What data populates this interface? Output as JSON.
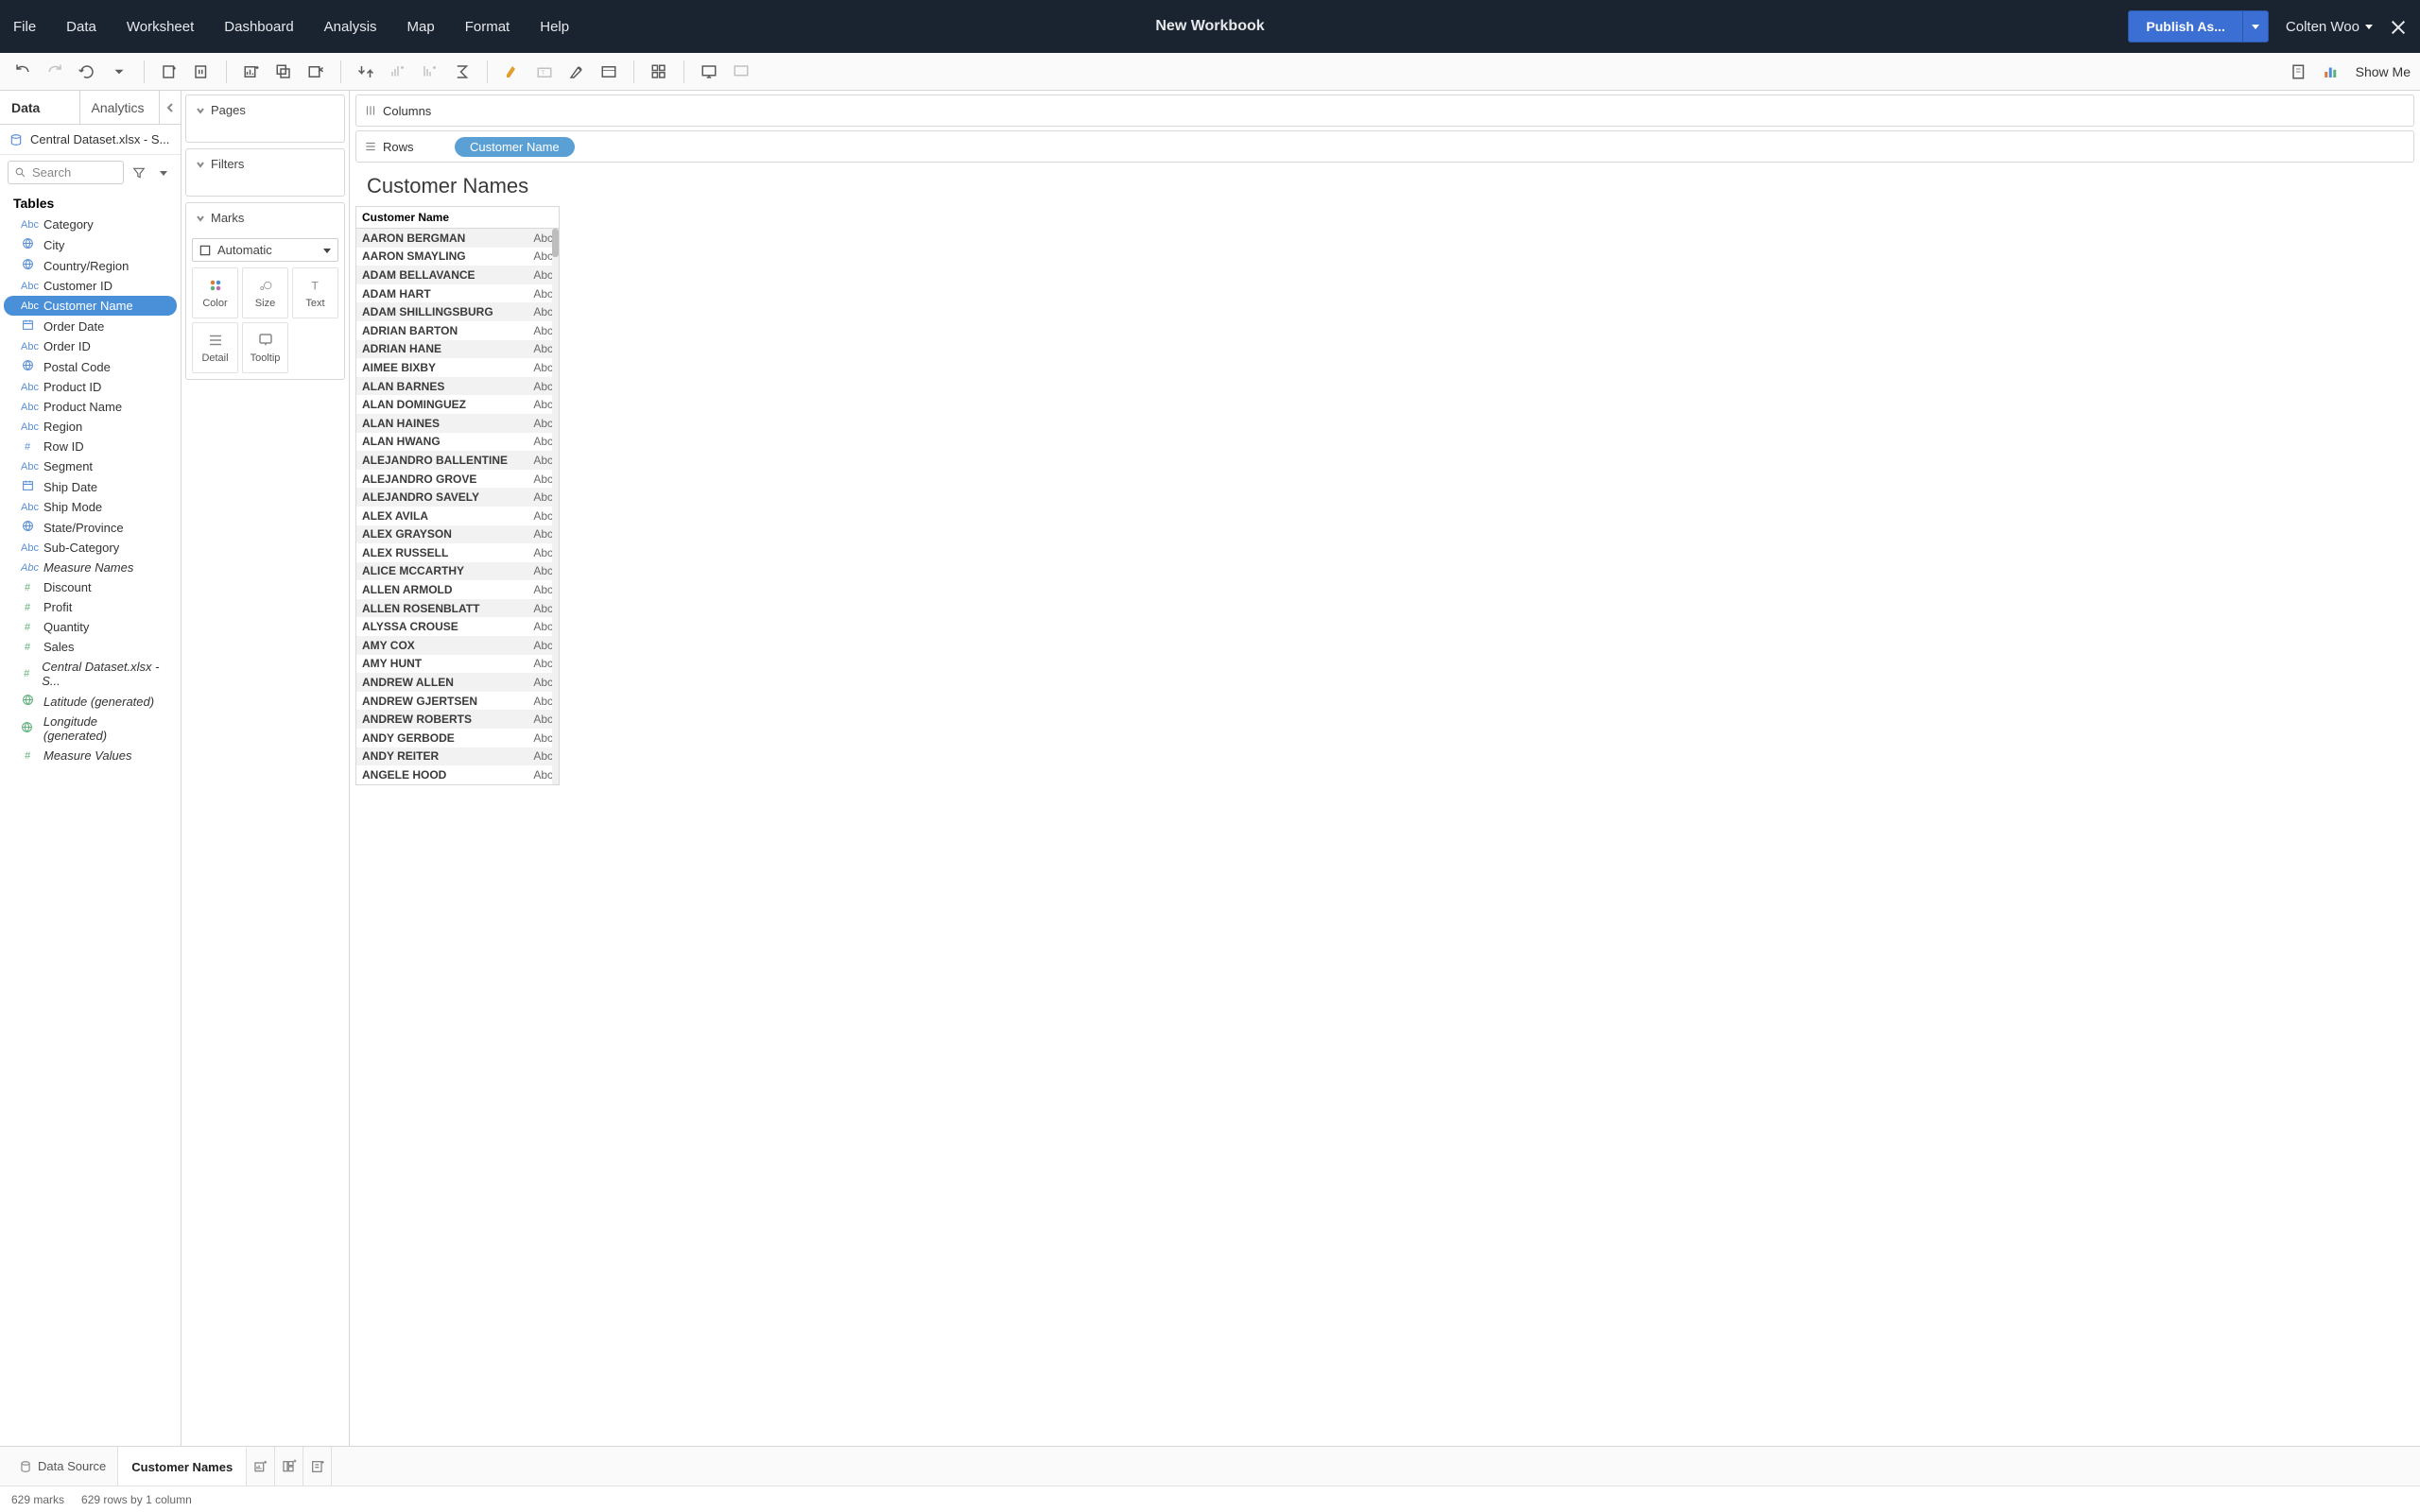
{
  "menubar": {
    "title": "New Workbook",
    "items": [
      "File",
      "Data",
      "Worksheet",
      "Dashboard",
      "Analysis",
      "Map",
      "Format",
      "Help"
    ],
    "publish_label": "Publish As...",
    "user": "Colten Woo"
  },
  "toolbar": {
    "showme_label": "Show Me"
  },
  "datapane": {
    "tab_data": "Data",
    "tab_analytics": "Analytics",
    "datasource": "Central Dataset.xlsx - S...",
    "search_placeholder": "Search",
    "tables_label": "Tables",
    "fields": [
      {
        "icon": "abc",
        "label": "Category"
      },
      {
        "icon": "globe",
        "label": "City"
      },
      {
        "icon": "globe",
        "label": "Country/Region"
      },
      {
        "icon": "abc",
        "label": "Customer ID"
      },
      {
        "icon": "abc",
        "label": "Customer Name",
        "selected": true
      },
      {
        "icon": "date",
        "label": "Order Date"
      },
      {
        "icon": "abc",
        "label": "Order ID"
      },
      {
        "icon": "globe",
        "label": "Postal Code"
      },
      {
        "icon": "abc",
        "label": "Product ID"
      },
      {
        "icon": "abc",
        "label": "Product Name"
      },
      {
        "icon": "abc",
        "label": "Region"
      },
      {
        "icon": "hash",
        "label": "Row ID"
      },
      {
        "icon": "abc",
        "label": "Segment"
      },
      {
        "icon": "date",
        "label": "Ship Date"
      },
      {
        "icon": "abc",
        "label": "Ship Mode"
      },
      {
        "icon": "globe",
        "label": "State/Province"
      },
      {
        "icon": "abc",
        "label": "Sub-Category"
      },
      {
        "icon": "abc",
        "label": "Measure Names",
        "italic": true
      },
      {
        "icon": "hash-m",
        "label": "Discount"
      },
      {
        "icon": "hash-m",
        "label": "Profit"
      },
      {
        "icon": "hash-m",
        "label": "Quantity"
      },
      {
        "icon": "hash-m",
        "label": "Sales"
      },
      {
        "icon": "hash-m",
        "label": "Central Dataset.xlsx - S...",
        "italic": true
      },
      {
        "icon": "globe-m",
        "label": "Latitude (generated)",
        "italic": true
      },
      {
        "icon": "globe-m",
        "label": "Longitude (generated)",
        "italic": true
      },
      {
        "icon": "hash-m",
        "label": "Measure Values",
        "italic": true
      }
    ]
  },
  "shelves": {
    "pages": "Pages",
    "filters": "Filters",
    "marks": "Marks",
    "marks_type": "Automatic",
    "cells": [
      "Color",
      "Size",
      "Text",
      "Detail",
      "Tooltip"
    ]
  },
  "viz": {
    "columns_label": "Columns",
    "rows_label": "Rows",
    "row_pill": "Customer Name",
    "sheet_title": "Customer Names",
    "column_header": "Customer Name",
    "abc": "Abc",
    "names": [
      "AARON BERGMAN",
      "AARON SMAYLING",
      "ADAM BELLAVANCE",
      "ADAM HART",
      "ADAM SHILLINGSBURG",
      "ADRIAN BARTON",
      "ADRIAN HANE",
      "AIMEE BIXBY",
      "ALAN BARNES",
      "ALAN DOMINGUEZ",
      "ALAN HAINES",
      "ALAN HWANG",
      "ALEJANDRO BALLENTINE",
      "ALEJANDRO GROVE",
      "ALEJANDRO SAVELY",
      "ALEX AVILA",
      "ALEX GRAYSON",
      "ALEX RUSSELL",
      "ALICE MCCARTHY",
      "ALLEN ARMOLD",
      "ALLEN ROSENBLATT",
      "ALYSSA CROUSE",
      "AMY COX",
      "AMY HUNT",
      "ANDREW ALLEN",
      "ANDREW GJERTSEN",
      "ANDREW ROBERTS",
      "ANDY GERBODE",
      "ANDY REITER",
      "ANGELE HOOD"
    ]
  },
  "tabstrip": {
    "datasource_label": "Data Source",
    "sheet_label": "Customer Names"
  },
  "status": {
    "marks": "629 marks",
    "detail": "629 rows by 1 column"
  }
}
